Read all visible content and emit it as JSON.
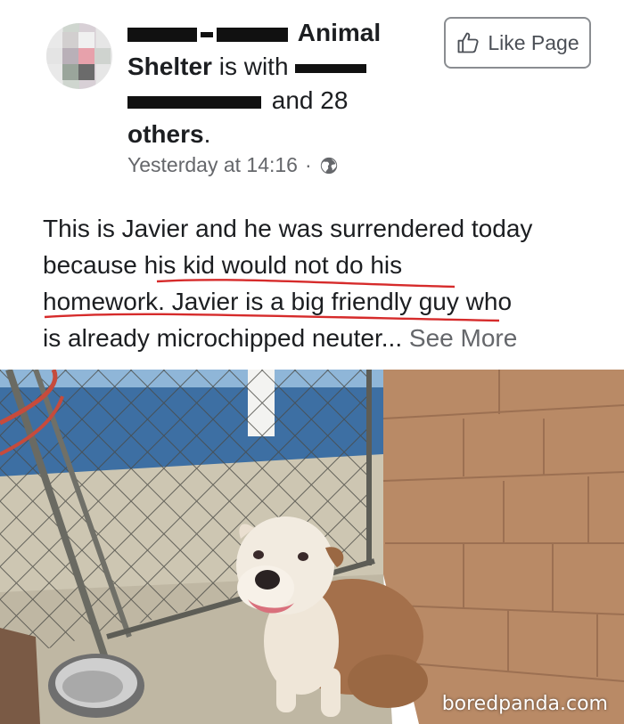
{
  "post": {
    "page_name_visible": "Animal",
    "page_name_line2": "Shelter",
    "with_text": "is with",
    "and_text": "and 28",
    "others_text": "others",
    "period": ".",
    "timestamp": "Yesterday at 14:16",
    "separator": "·",
    "body_line1": "This is Javier and he was surrendered today",
    "body_line2": "because his kid would not do his",
    "body_line3": "homework. Javier is a big friendly guy who",
    "body_line4": "is already microchipped neuter...",
    "see_more": "See More"
  },
  "like_button": {
    "label": "Like Page"
  },
  "photo": {
    "watermark": "boredpanda.com"
  },
  "colors": {
    "text_primary": "#1c1e21",
    "text_secondary": "#65676b",
    "underline": "#d62b2b",
    "wall": "#b98a66",
    "floor": "#c9c4b3"
  },
  "icons": [
    "avatar",
    "globe-icon",
    "thumbs-up-icon"
  ]
}
